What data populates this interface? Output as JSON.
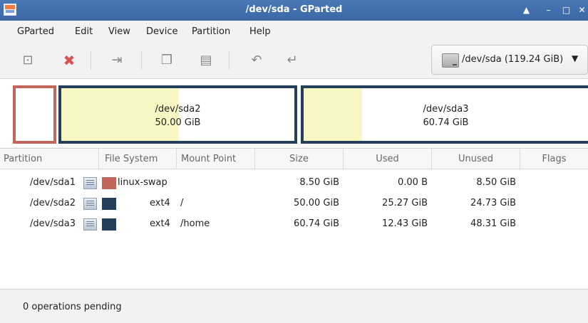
{
  "window": {
    "title": "/dev/sda - GParted"
  },
  "menu": {
    "items": [
      "GParted",
      "Edit",
      "View",
      "Device",
      "Partition",
      "Help"
    ]
  },
  "toolbar": {
    "buttons": [
      "new-partition-icon",
      "delete-icon",
      "resize-move-icon",
      "copy-icon",
      "paste-icon",
      "undo-icon",
      "apply-icon"
    ]
  },
  "device": {
    "label": "/dev/sda (119.24 GiB)"
  },
  "diskmap": {
    "sda2": {
      "name": "/dev/sda2",
      "size": "50.00 GiB",
      "used_fraction": 0.505
    },
    "sda3": {
      "name": "/dev/sda3",
      "size": "60.74 GiB",
      "used_fraction": 0.205
    }
  },
  "table": {
    "headers": [
      "Partition",
      "File System",
      "Mount Point",
      "Size",
      "Used",
      "Unused",
      "Flags"
    ],
    "rows": [
      {
        "partition": "/dev/sda1",
        "filesystem": "linux-swap",
        "mountpoint": "",
        "size": "8.50 GiB",
        "used": "0.00 B",
        "unused": "8.50 GiB",
        "flags": "",
        "color": "#c1665a"
      },
      {
        "partition": "/dev/sda2",
        "filesystem": "ext4",
        "mountpoint": "/",
        "size": "50.00 GiB",
        "used": "25.27 GiB",
        "unused": "24.73 GiB",
        "flags": "",
        "color": "#233f5c"
      },
      {
        "partition": "/dev/sda3",
        "filesystem": "ext4",
        "mountpoint": "/home",
        "size": "60.74 GiB",
        "used": "12.43 GiB",
        "unused": "48.31 GiB",
        "flags": "",
        "color": "#233f5c"
      }
    ]
  },
  "status": {
    "text": "0 operations pending"
  },
  "colors": {
    "titlebar": "#3a68a6",
    "swap": "#c1665a",
    "ext4": "#233f5c",
    "used_fill": "#f8f7c3"
  }
}
